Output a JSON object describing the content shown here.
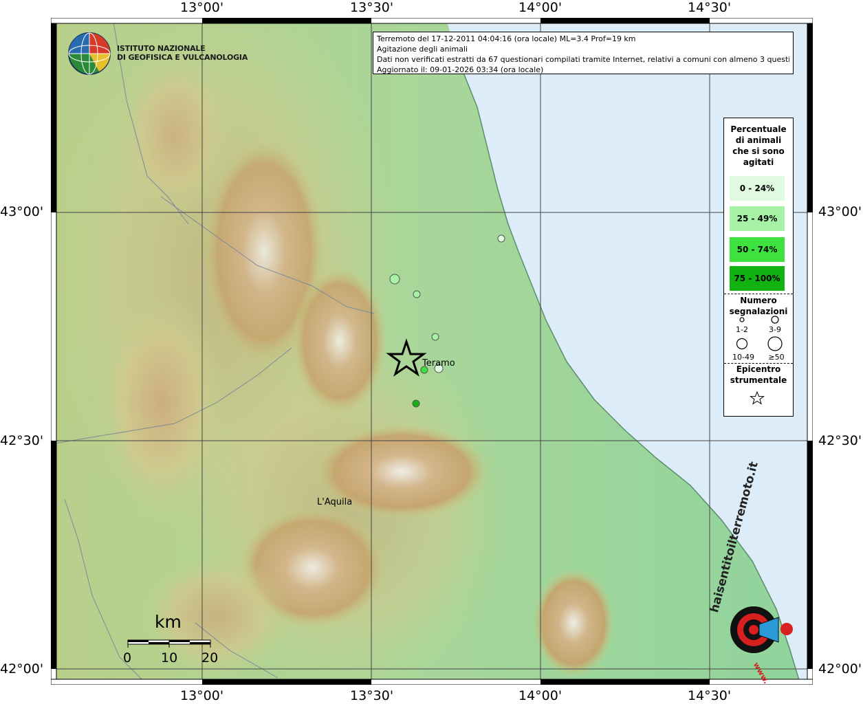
{
  "map": {
    "longitude_labels": [
      "13°00'",
      "13°30'",
      "14°00'",
      "14°30'"
    ],
    "latitude_labels": [
      "43°00'",
      "42°30'",
      "42°00'"
    ],
    "colors": {
      "sea": "#dcecf8",
      "lowland": "#9fd49a",
      "hills": "#c8d48c",
      "mountains": "#c9a070",
      "peaks": "#f4f2f0",
      "grid": "#444444"
    }
  },
  "header": {
    "line1": "Terremoto del 17-12-2011 04:04:16 (ora locale) ML=3.4 Prof=19 km",
    "line2": "Agitazione degli animali",
    "line3": "Dati non verificati estratti da 67 questionari compilati tramite Internet, relativi a comuni con almeno 3 questionari.",
    "line4": "Aggiornato il: 09-01-2026 03:34 (ora locale)"
  },
  "ingv_logo": {
    "line1": "ISTITUTO NAZIONALE",
    "line2": "DI GEOFISICA E VULCANOLOGIA"
  },
  "legend": {
    "title": [
      "Percentuale",
      "di animali",
      "che si sono",
      "agitati"
    ],
    "classes": [
      {
        "label": "0 - 24%",
        "color": "#e0fbe0"
      },
      {
        "label": "25 - 49%",
        "color": "#a6f2a6"
      },
      {
        "label": "50 - 74%",
        "color": "#3ee23e"
      },
      {
        "label": "75 - 100%",
        "color": "#12b212"
      }
    ],
    "count_title": [
      "Numero",
      "segnalazioni"
    ],
    "counts": [
      "1-2",
      "3-9",
      "10-49",
      "≥50"
    ],
    "epicenter_title": [
      "Epicentro",
      "strumentale"
    ]
  },
  "places": {
    "teramo": "Teramo",
    "laquila": "L'Aquila"
  },
  "scale": {
    "unit": "km",
    "ticks": [
      "0",
      "10",
      "20"
    ]
  },
  "watermark": {
    "text": "haisentitoilterremoto.it",
    "www": "www."
  },
  "observations": [
    {
      "pct_class": "0 - 24%",
      "count": "3-9"
    },
    {
      "pct_class": "25 - 49%",
      "count": "10-49"
    },
    {
      "pct_class": "25 - 49%",
      "count": "3-9"
    },
    {
      "pct_class": "25 - 49%",
      "count": "3-9"
    },
    {
      "pct_class": "50 - 74%",
      "count": "3-9"
    },
    {
      "pct_class": "0 - 24%",
      "count": "10-49"
    },
    {
      "pct_class": "75 - 100%",
      "count": "3-9"
    }
  ]
}
